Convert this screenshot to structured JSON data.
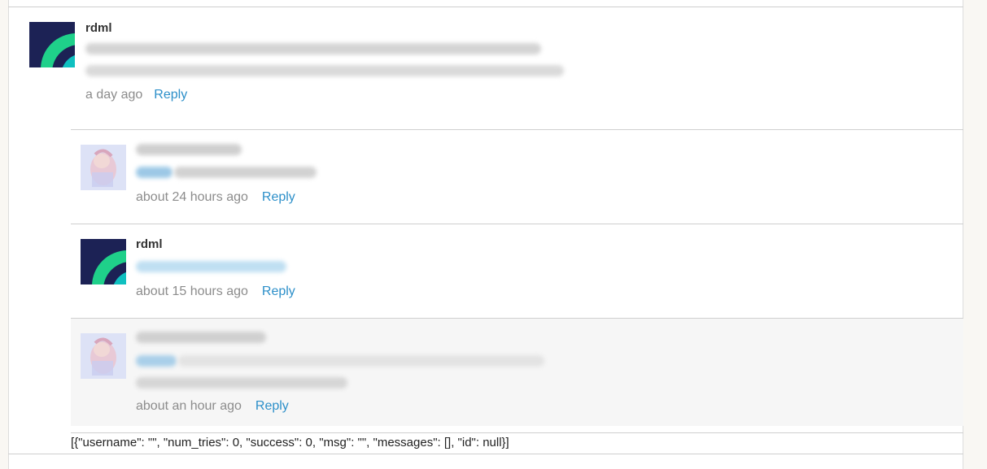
{
  "colors": {
    "link": "#2c8fc9",
    "meta_text": "#8c8c8c",
    "author_text": "#333333",
    "avatar_dark": "#1c2255",
    "avatar_green": "#1fd08a",
    "avatar_teal": "#0fc0c0"
  },
  "comments": [
    {
      "author": "rdml",
      "avatar_icon": "rdml-logo-icon",
      "time": "a day ago",
      "reply_label": "Reply",
      "body_blurred": true
    },
    {
      "author": "",
      "avatar_icon": "anime-avatar-icon",
      "time": "about 24 hours ago",
      "reply_label": "Reply",
      "body_blurred": true
    },
    {
      "author": "rdml",
      "avatar_icon": "rdml-logo-icon",
      "time": "about 15 hours ago",
      "reply_label": "Reply",
      "body_blurred": true
    },
    {
      "author": "",
      "avatar_icon": "anime-avatar-icon",
      "time": "about an hour ago",
      "reply_label": "Reply",
      "body_blurred": true
    }
  ],
  "debug_output": "[{\"username\": \"\", \"num_tries\": 0, \"success\": 0, \"msg\": \"\", \"messages\": [], \"id\": null}]"
}
